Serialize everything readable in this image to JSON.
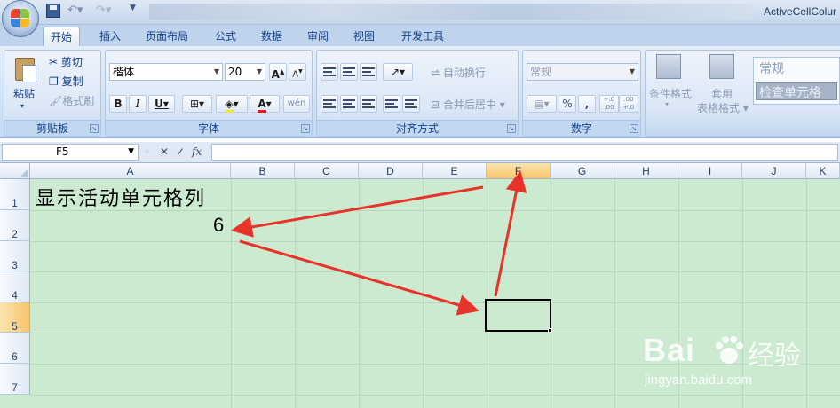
{
  "window": {
    "title": "ActiveCellColur"
  },
  "tabs": [
    "开始",
    "插入",
    "页面布局",
    "公式",
    "数据",
    "审阅",
    "视图",
    "开发工具"
  ],
  "ribbon": {
    "clipboard": {
      "paste": "粘贴",
      "cut": "剪切",
      "copy": "复制",
      "format_painter": "格式刷",
      "label": "剪贴板"
    },
    "font": {
      "name": "楷体",
      "size": "20",
      "bold": "B",
      "italic": "I",
      "underline": "U",
      "font_color_letter": "A",
      "phonetic": "wén",
      "label": "字体"
    },
    "alignment": {
      "wrap_text": "自动换行",
      "merge_center": "合并后居中",
      "label": "对齐方式"
    },
    "number": {
      "format": "常规",
      "percent": "%",
      "comma": ",",
      "inc_decimal": "+.0 .00",
      "dec_decimal": ".00 +.0",
      "label": "数字"
    },
    "styles": {
      "conditional_format": "条件格式",
      "table_format_1": "套用",
      "table_format_2": "表格格式",
      "normal": "常规",
      "check_cell": "检查单元格"
    }
  },
  "formula_bar": {
    "name_box": "F5",
    "fx": "fx",
    "content": ""
  },
  "sheet": {
    "columns": [
      "A",
      "B",
      "C",
      "D",
      "E",
      "F",
      "G",
      "H",
      "I",
      "J",
      "K"
    ],
    "rows": [
      "1",
      "2",
      "3",
      "4",
      "5",
      "6",
      "7"
    ],
    "selected_column": "F",
    "selected_row": "5",
    "cells": {
      "A1": "显示活动单元格列",
      "A2": "6"
    },
    "grid_color": "#cceacf",
    "arrow_color": "#e8332a"
  },
  "watermark": {
    "brand": "Bai",
    "brand_tail": "经验",
    "url": "jingyan.baidu.com"
  }
}
